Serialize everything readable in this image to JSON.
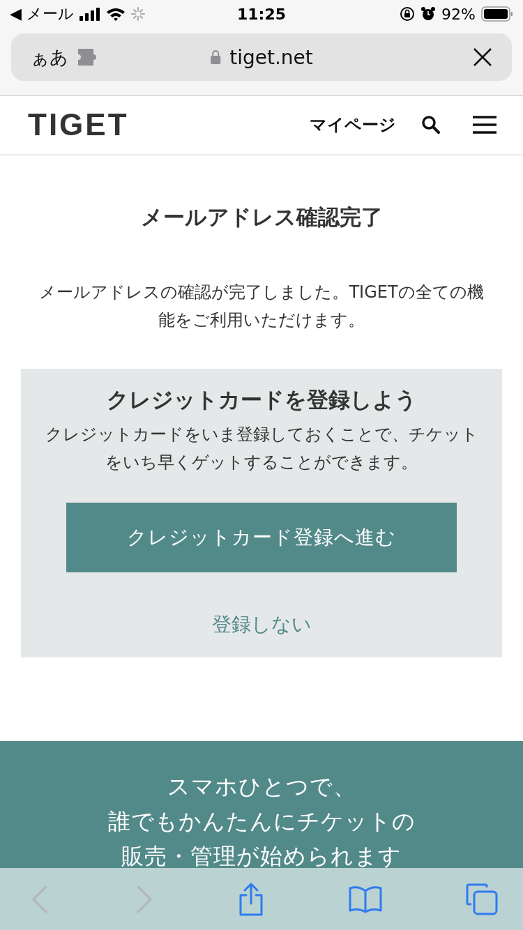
{
  "status_bar": {
    "back_label": "◀ メール",
    "time": "11:25",
    "battery": "92%"
  },
  "address_bar": {
    "text_size": "ぁあ",
    "url": "tiget.net"
  },
  "header": {
    "logo": "TIGET",
    "mypage": "マイページ"
  },
  "title": "メールアドレス確認完了",
  "message": "メールアドレスの確認が完了しました。TIGETの全ての機能をご利用いただけます。",
  "card": {
    "title": "クレジットカードを登録しよう",
    "text": "クレジットカードをいま登録しておくことで、チケットをいち早くゲットすることができます。",
    "button": "クレジットカード登録へ進む",
    "skip_link": "登録しない"
  },
  "promo": {
    "lines": [
      "スマホひとつで、",
      "誰でもかんたんにチケットの",
      "販売・管理が始められます"
    ]
  }
}
